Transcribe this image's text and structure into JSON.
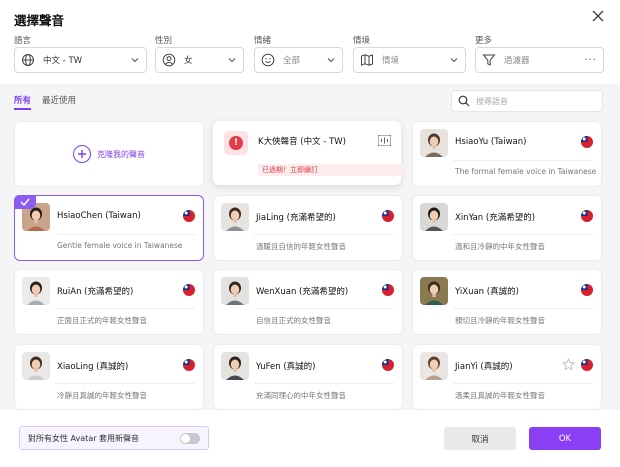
{
  "dialog": {
    "title": "選擇聲音"
  },
  "filters": [
    {
      "label": "語言",
      "value": "中文 - TW",
      "icon": "globe-icon",
      "placeholder": false
    },
    {
      "label": "性別",
      "value": "女",
      "icon": "gender-icon",
      "placeholder": false
    },
    {
      "label": "情緒",
      "value": "全部",
      "icon": "smile-icon",
      "placeholder": true
    },
    {
      "label": "情境",
      "value": "情境",
      "icon": "map-icon",
      "placeholder": true
    },
    {
      "label": "更多",
      "value": "過濾器",
      "icon": "filter-icon",
      "placeholder": true
    }
  ],
  "tabs": {
    "all": "所有",
    "recent": "最近使用"
  },
  "search": {
    "placeholder": "搜尋語音"
  },
  "clone": {
    "label": "克隆我的聲音"
  },
  "expired_voice": {
    "name": "K大俠聲音 (中文 - TW)",
    "notice": "已過期！立即續訂"
  },
  "voices": [
    {
      "name": "HsiaoYu (Taiwan)",
      "desc": "The formal female voice in Taiwanese"
    },
    {
      "name": "HsiaoChen (Taiwan)",
      "desc": "Gentle female voice in Taiwanese",
      "selected": true
    },
    {
      "name": "JiaLing (充滿希望的)",
      "desc": "溫暖且自信的年輕女性聲音"
    },
    {
      "name": "XinYan (充滿希望的)",
      "desc": "溫和且冷靜的中年女性聲音"
    },
    {
      "name": "RuiAn (充滿希望的)",
      "desc": "正面且正式的年輕女性聲音"
    },
    {
      "name": "WenXuan (充滿希望的)",
      "desc": "自信且正式的女性聲音"
    },
    {
      "name": "YiXuan (真誠的)",
      "desc": "親切且冷靜的年輕女性聲音"
    },
    {
      "name": "XiaoLing (真誠的)",
      "desc": "冷靜且真誠的年輕女性聲音"
    },
    {
      "name": "YuFen (真誠的)",
      "desc": "充滿同理心的中年女性聲音"
    },
    {
      "name": "JianYi (真誠的)",
      "desc": "溫柔且真誠的年輕女性聲音",
      "star": true
    }
  ],
  "footer": {
    "toggle_label": "對所有女性 Avatar 套用新聲音",
    "toggle_on": false,
    "cancel": "取消",
    "ok": "OK"
  },
  "colors": {
    "accent": "#8a3ff5",
    "error": "#e23b4a"
  }
}
